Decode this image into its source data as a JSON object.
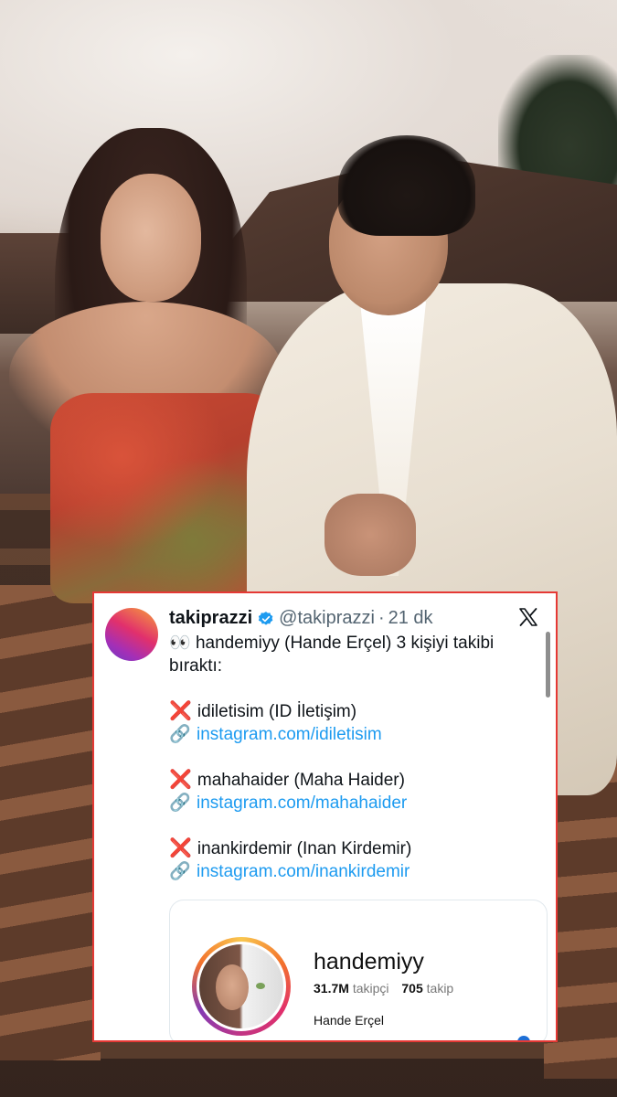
{
  "tweet": {
    "display_name": "takiprazzi",
    "handle": "@takiprazzi",
    "separator": "·",
    "time": "21 dk",
    "intro_emoji": "👀",
    "intro_line1": "handemiyy (Hande Erçel) 3 kişiyi takibi",
    "intro_line2": "bıraktı:",
    "entries": [
      {
        "mark": "❌",
        "name": "idiletisim (ID İletişim)",
        "link_icon": "🔗",
        "link": "instagram.com/idiletisim"
      },
      {
        "mark": "❌",
        "name": "mahahaider (Maha Haider)",
        "link_icon": "🔗",
        "link": "instagram.com/mahahaider"
      },
      {
        "mark": "❌",
        "name": "inankirdemir (Inan Kirdemir)",
        "link_icon": "🔗",
        "link": "instagram.com/inankirdemir"
      }
    ]
  },
  "embed": {
    "username": "handemiyy",
    "followers_value": "31.7M",
    "followers_label": "takipçi",
    "following_value": "705",
    "following_label": "takip",
    "full_name": "Hande Erçel"
  },
  "colors": {
    "frame_border": "#e53935",
    "link": "#1d9bf0",
    "verified": "#1d9bf0"
  }
}
